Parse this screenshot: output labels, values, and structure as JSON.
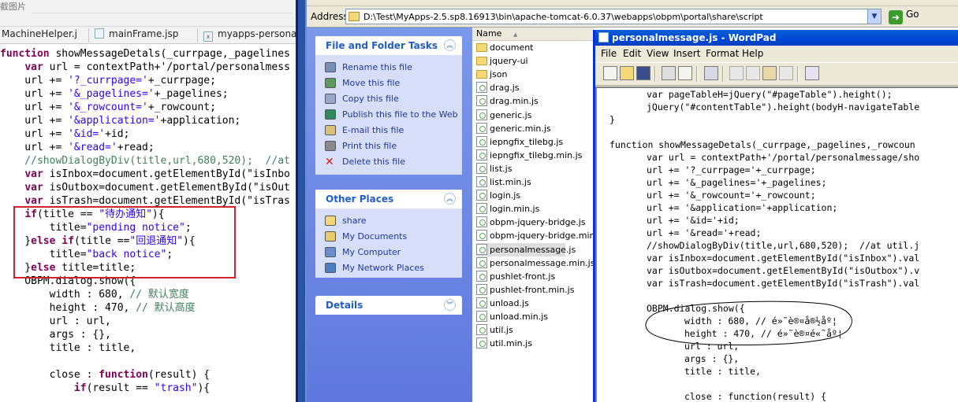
{
  "editor": {
    "window_title": "截图片",
    "tabs": [
      {
        "label": "MachineHelper.j"
      },
      {
        "label": "mainFrame.jsp"
      },
      {
        "label": "myapps-persona"
      }
    ],
    "code_lines": [
      "function showMessageDetals(_currpage,_pagelines",
      "    var url = contextPath+'/portal/personalmess",
      "    url += '?_currpage='+_currpage;",
      "    url += '&_pagelines='+_pagelines;",
      "    url += '&_rowcount='+_rowcount;",
      "    url += '&application='+application;",
      "    url += '&id='+id;",
      "    url += '&read='+read;",
      "    //showDialogByDiv(title,url,680,520);  //at",
      "    var isInbox=document.getElementById(\"isInbo",
      "    var isOutbox=document.getElementById(\"isOut",
      "    var isTrash=document.getElementById(\"isTras",
      "    if(title == \"待办通知\"){",
      "        title=\"pending notice\";",
      "    }else if(title ==\"回退通知\"){",
      "        title=\"back notice\";",
      "    }else title=title;",
      "    OBPM.dialog.show({",
      "        width : 680, // 默认宽度",
      "        height : 470, // 默认高度",
      "        url : url,",
      "        args : {},",
      "        title : title,",
      "",
      "        close : function(result) {",
      "            if(result == \"trash\"){"
    ]
  },
  "explorer": {
    "address_label": "Address",
    "address_value": "D:\\Test\\MyApps-2.5.sp8.16913\\bin\\apache-tomcat-6.0.37\\webapps\\obpm\\portal\\share\\script",
    "go_label": "Go",
    "file_tasks": {
      "title": "File and Folder Tasks",
      "items": [
        {
          "label": "Rename this file",
          "icon": "rename-icon"
        },
        {
          "label": "Move this file",
          "icon": "move-icon"
        },
        {
          "label": "Copy this file",
          "icon": "copy-icon"
        },
        {
          "label": "Publish this file to the Web",
          "icon": "globe-icon"
        },
        {
          "label": "E-mail this file",
          "icon": "email-icon"
        },
        {
          "label": "Print this file",
          "icon": "print-icon"
        },
        {
          "label": "Delete this file",
          "icon": "delete-icon"
        }
      ]
    },
    "other_places": {
      "title": "Other Places",
      "items": [
        {
          "label": "share",
          "icon": "folder-icon"
        },
        {
          "label": "My Documents",
          "icon": "my-documents-icon"
        },
        {
          "label": "My Computer",
          "icon": "my-computer-icon"
        },
        {
          "label": "My Network Places",
          "icon": "network-icon"
        }
      ]
    },
    "details": {
      "title": "Details"
    },
    "name_column": "Name",
    "files": [
      {
        "name": "document",
        "type": "folder"
      },
      {
        "name": "jquery-ui",
        "type": "folder"
      },
      {
        "name": "json",
        "type": "folder"
      },
      {
        "name": "drag.js",
        "type": "js"
      },
      {
        "name": "drag.min.js",
        "type": "js"
      },
      {
        "name": "generic.js",
        "type": "js"
      },
      {
        "name": "generic.min.js",
        "type": "js"
      },
      {
        "name": "iepngfix_tilebg.js",
        "type": "js"
      },
      {
        "name": "iepngfix_tilebg.min.js",
        "type": "js"
      },
      {
        "name": "list.js",
        "type": "js"
      },
      {
        "name": "list.min.js",
        "type": "js"
      },
      {
        "name": "login.js",
        "type": "js"
      },
      {
        "name": "login.min.js",
        "type": "js"
      },
      {
        "name": "obpm-jquery-bridge.js",
        "type": "js"
      },
      {
        "name": "obpm-jquery-bridge.min.js",
        "type": "js"
      },
      {
        "name": "personalmessage.js",
        "type": "js",
        "selected": true
      },
      {
        "name": "personalmessage.min.js",
        "type": "js"
      },
      {
        "name": "pushlet-front.js",
        "type": "js"
      },
      {
        "name": "pushlet-front.min.js",
        "type": "js"
      },
      {
        "name": "unload.js",
        "type": "js"
      },
      {
        "name": "unload.min.js",
        "type": "js"
      },
      {
        "name": "util.js",
        "type": "js"
      },
      {
        "name": "util.min.js",
        "type": "js"
      }
    ]
  },
  "wordpad": {
    "title": "personalmessage.js - WordPad",
    "menu": [
      "File",
      "Edit",
      "View",
      "Insert",
      "Format",
      "Help"
    ],
    "lines": [
      {
        "indent": 1,
        "text": "var pageTableH=jQuery(\"#pageTable\").height();"
      },
      {
        "indent": 1,
        "text": "jQuery(\"#contentTable\").height(bodyH-navigateTable"
      },
      {
        "indent": 0,
        "text": "}"
      },
      {
        "indent": 0,
        "text": ""
      },
      {
        "indent": 0,
        "text": "function showMessageDetals(_currpage,_pagelines,_rowcoun"
      },
      {
        "indent": 1,
        "text": "var url = contextPath+'/portal/personalmessage/sho"
      },
      {
        "indent": 1,
        "text": "url += '?_currpage='+_currpage;"
      },
      {
        "indent": 1,
        "text": "url += '&_pagelines='+_pagelines;"
      },
      {
        "indent": 1,
        "text": "url += '&_rowcount='+_rowcount;"
      },
      {
        "indent": 1,
        "text": "url += '&application='+application;"
      },
      {
        "indent": 1,
        "text": "url += '&id='+id;"
      },
      {
        "indent": 1,
        "text": "url += '&read='+read;"
      },
      {
        "indent": 1,
        "text": "//showDialogByDiv(title,url,680,520);  //at util.j"
      },
      {
        "indent": 1,
        "text": "var isInbox=document.getElementById(\"isInbox\").val"
      },
      {
        "indent": 1,
        "text": "var isOutbox=document.getElementById(\"isOutbox\").v"
      },
      {
        "indent": 1,
        "text": "var isTrash=document.getElementById(\"isTrash\").val"
      },
      {
        "indent": 0,
        "text": ""
      },
      {
        "indent": 1,
        "text": "OBPM.dialog.show({"
      },
      {
        "indent": 2,
        "text": "width : 680, // é»˜è®¤å®½åº¦"
      },
      {
        "indent": 2,
        "text": "height : 470, // é»˜è®¤é«˜åº¦"
      },
      {
        "indent": 2,
        "text": "url : url,"
      },
      {
        "indent": 2,
        "text": "args : {},"
      },
      {
        "indent": 2,
        "text": "title : title,"
      },
      {
        "indent": 0,
        "text": ""
      },
      {
        "indent": 2,
        "text": "close : function(result) {"
      }
    ]
  },
  "colors": {
    "highlight_box": "#d0222a",
    "xp_blue": "#0046d5",
    "task_link": "#21349c"
  }
}
